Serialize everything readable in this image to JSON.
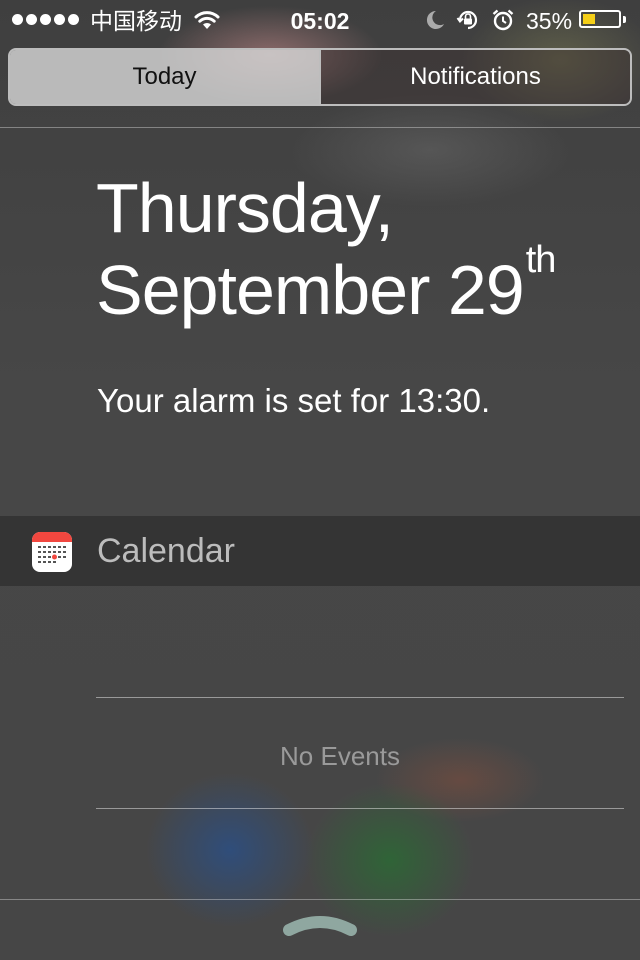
{
  "status_bar": {
    "carrier": "中国移动",
    "time": "05:02",
    "battery_percent": "35%",
    "battery_level": 0.35,
    "battery_color": "#f5cf18",
    "signal_dots": 5,
    "icons": [
      "wifi-icon",
      "moon-icon",
      "rotation-lock-icon",
      "alarm-icon",
      "battery-icon"
    ]
  },
  "tabs": {
    "today": "Today",
    "notifications": "Notifications",
    "selected": "today"
  },
  "date": {
    "weekday": "Thursday,",
    "month_day": "September 29",
    "ordinal_suffix": "th"
  },
  "alarm": {
    "message": "Your alarm is set for 13:30."
  },
  "calendar": {
    "title": "Calendar",
    "icon": "calendar-app-icon",
    "accent_color": "#f1473f",
    "empty_message": "No Events"
  },
  "footer": {
    "icon": "grabber-handle-icon"
  }
}
